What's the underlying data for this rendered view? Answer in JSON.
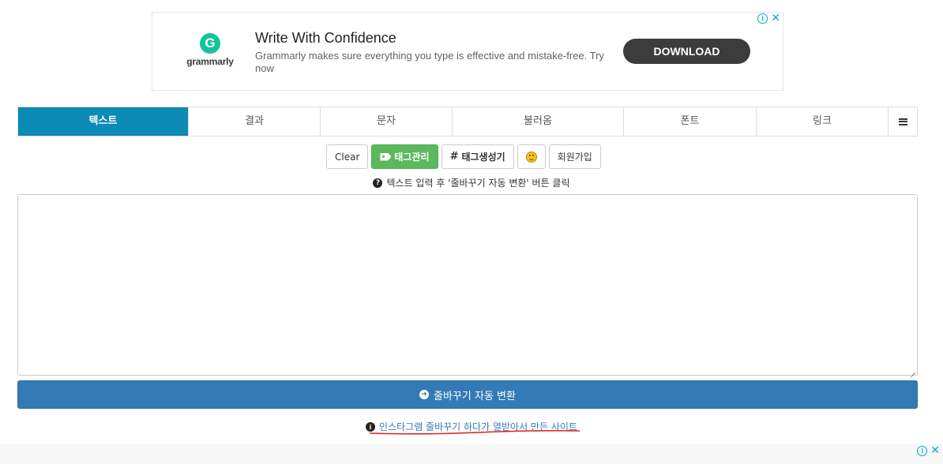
{
  "ad_top": {
    "logo_text": "grammarly",
    "logo_letter": "G",
    "headline": "Write With Confidence",
    "description": "Grammarly makes sure everything you type is effective and mistake-free. Try now",
    "cta": "DOWNLOAD",
    "info_glyph": "i",
    "close_glyph": "✕"
  },
  "tabs": [
    {
      "label": "텍스트",
      "active": true
    },
    {
      "label": "결과"
    },
    {
      "label": "문자"
    },
    {
      "label": "불러옴"
    },
    {
      "label": "폰트"
    },
    {
      "label": "링크"
    }
  ],
  "toolbar": {
    "clear": "Clear",
    "tag_manage": "태그관리",
    "tag_generate": "태그생성기",
    "hash_glyph": "#",
    "signup": "회원가입"
  },
  "hint": {
    "icon_glyph": "?",
    "text": "텍스트 입력 후 '줄바꾸기 자동 변환' 버튼 클릭"
  },
  "editor": {
    "value": ""
  },
  "convert": {
    "icon_glyph": "➜",
    "label": "줄바꾸기 자동 변환"
  },
  "footer": {
    "icon_glyph": "i",
    "link_text": "인스타그램 줄바꾸기 하다가 열받아서 만든 사이트"
  },
  "colors": {
    "tab_active": "#0b8ab5",
    "green_button": "#5cb85c",
    "primary_button": "#337ab7",
    "grammarly_green": "#15c39a",
    "underline_red": "#e02020"
  }
}
